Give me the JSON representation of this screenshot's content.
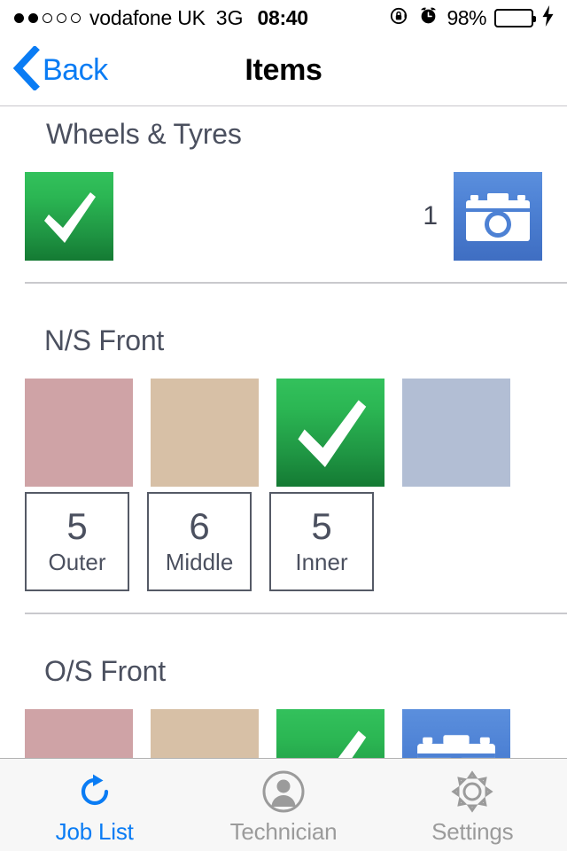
{
  "status_bar": {
    "signal_dots": [
      true,
      true,
      false,
      false,
      false
    ],
    "carrier": "vodafone UK",
    "network": "3G",
    "time": "08:40",
    "rotation_lock_icon": "rotation-lock-icon",
    "alarm_icon": "alarm-clock-icon",
    "battery_percent": "98%",
    "battery_level": 98,
    "battery_color": "#4CD964",
    "charging": true
  },
  "nav_bar": {
    "back_label": "Back",
    "back_icon": "chevron-left-icon",
    "title": "Items",
    "accent_color": "#0a7cf4"
  },
  "sections": [
    {
      "title": "Wheels & Tyres",
      "tick_state": "checked",
      "photo_count": "1",
      "camera_icon": "camera-icon",
      "tick_icon": "check-icon"
    },
    {
      "title": "N/S Front",
      "swatches": [
        {
          "name": "swatch-pink",
          "color": "#cfa3a6"
        },
        {
          "name": "swatch-tan",
          "color": "#d7c0a6"
        },
        {
          "name": "swatch-green-checked",
          "color": "#2bb653"
        },
        {
          "name": "swatch-blue",
          "color": "#b2bed4"
        }
      ],
      "tread": [
        {
          "value": "5",
          "label": "Outer"
        },
        {
          "value": "6",
          "label": "Middle"
        },
        {
          "value": "5",
          "label": "Inner"
        }
      ]
    },
    {
      "title": "O/S Front",
      "swatches": [
        {
          "name": "swatch-pink",
          "color": "#cfa3a6"
        },
        {
          "name": "swatch-tan",
          "color": "#d7c0a6"
        },
        {
          "name": "swatch-green-checked",
          "color": "#2bb653"
        },
        {
          "name": "swatch-camera",
          "color": "#4d81d4"
        }
      ]
    }
  ],
  "tab_bar": {
    "tabs": [
      {
        "label": "Job List",
        "icon": "refresh-icon",
        "active": true
      },
      {
        "label": "Technician",
        "icon": "person-icon",
        "active": false
      },
      {
        "label": "Settings",
        "icon": "gear-icon",
        "active": false
      }
    ],
    "active_color": "#0a7cf4",
    "inactive_color": "#9b9b9b"
  }
}
